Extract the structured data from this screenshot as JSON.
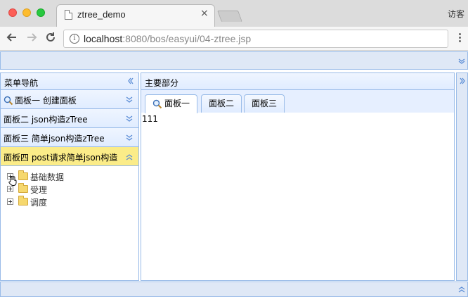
{
  "browser": {
    "tab_title": "ztree_demo",
    "tab_close": "×",
    "user_label": "访客",
    "url_host": "localhost",
    "url_rest": ":8080/bos/easyui/04-ztree.jsp",
    "info_icon": "i"
  },
  "layout": {
    "west": {
      "title": "菜单导航",
      "accordion": [
        {
          "title": "面板一 创建面板",
          "icon": "search-icon",
          "state": "collapsed"
        },
        {
          "title": "面板二 json构造zTree",
          "state": "collapsed"
        },
        {
          "title": "面板三 简单json构造zTree",
          "state": "collapsed"
        },
        {
          "title": "面板四 post请求简单json构造",
          "state": "expanded"
        }
      ],
      "tree": [
        {
          "label": "基础数据"
        },
        {
          "label": "受理"
        },
        {
          "label": "调度"
        }
      ]
    },
    "center": {
      "title": "主要部分",
      "tabs": [
        {
          "label": "面板一",
          "icon": "search-icon",
          "active": true
        },
        {
          "label": "面板二",
          "active": false
        },
        {
          "label": "面板三",
          "active": false
        }
      ],
      "content": "111"
    }
  },
  "colors": {
    "panel_border": "#99bbe8",
    "panel_bg": "#dfe8f6",
    "selected_header": "#fbec88",
    "chevron": "#5b8dd6"
  }
}
